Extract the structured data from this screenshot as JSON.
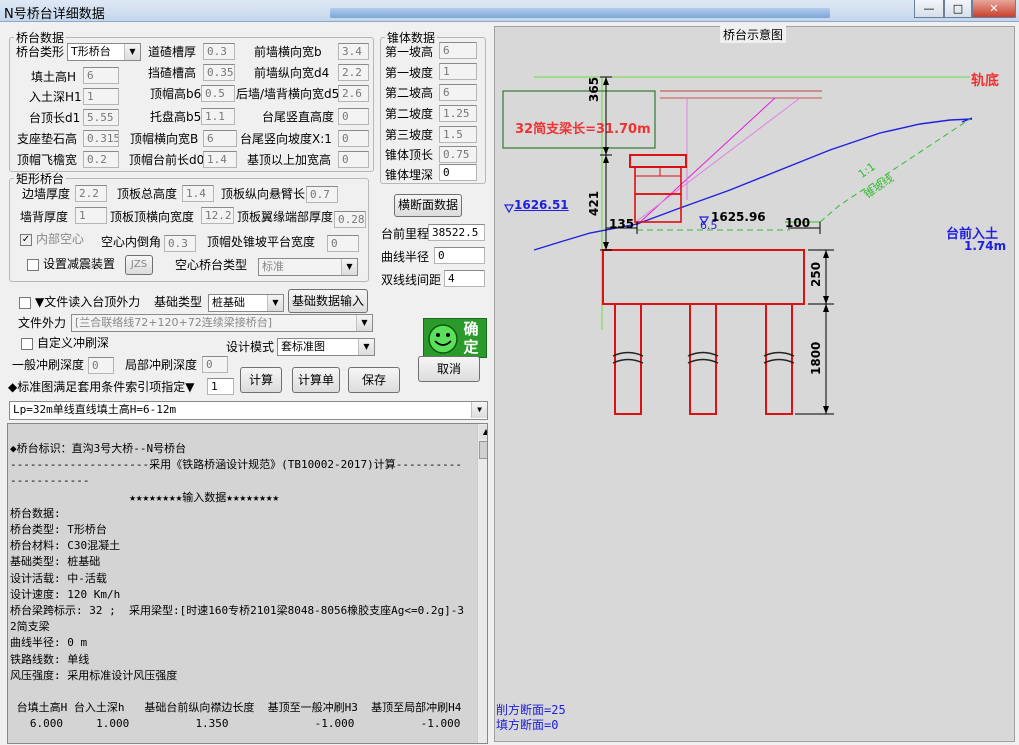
{
  "window": {
    "title": "N号桥台详细数据",
    "btn_min": "—",
    "btn_max": "□",
    "btn_close": "✕"
  },
  "bridge": {
    "group_title": "桥台数据",
    "type_label": "桥台类形",
    "type_value": "T形桥台",
    "f_label_1": "填土高H",
    "f_value_1": "6",
    "f_label_2": "入土深H1",
    "f_value_2": "1",
    "f_label_3": "台顶长d1",
    "f_value_3": "5.55",
    "f_label_4": "支座垫石高",
    "f_value_4": "0.315",
    "f_label_5": "顶帽飞檐宽",
    "f_value_5": "0.2",
    "f_label_6": "道碴槽厚",
    "f_value_6": "0.3",
    "f_label_7": "挡碴槽高",
    "f_value_7": "0.35",
    "f_label_8": "顶帽高b6",
    "f_value_8": "0.5",
    "f_label_9": "托盘高b5",
    "f_value_9": "1.1",
    "f_label_10": "顶帽横向宽B",
    "f_value_10": "6",
    "f_label_11": "顶帽台前长d0",
    "f_value_11": "1.4",
    "f_label_12": "前墙横向宽b",
    "f_value_12": "3.4",
    "f_label_13": "前墙纵向宽d4",
    "f_value_13": "2.2",
    "f_label_14": "后墙/墙背横向宽d5",
    "f_value_14": "2.6",
    "f_label_15": "台尾竖直高度",
    "f_value_15": "0",
    "f_label_16": "台尾竖向坡度X:1",
    "f_value_16": "0",
    "f_label_17": "基顶以上加宽高",
    "f_value_17": "0"
  },
  "rect": {
    "group_title": "矩形桥台",
    "f_label_1": "边墙厚度",
    "f_value_1": "2.2",
    "f_label_2": "墙背厚度",
    "f_value_2": "1",
    "f_label_3": "顶板总高度",
    "f_value_3": "1.4",
    "f_label_4": "顶板顶横向宽度",
    "f_value_4": "12.2",
    "f_label_5": "顶板纵向悬臂长",
    "f_value_5": "0.7",
    "f_label_6": "顶板翼缘端部厚度",
    "f_value_6": "0.28",
    "hollow_label": "内部空心",
    "hollow_checked": "✓",
    "chamfer_label": "空心内倒角",
    "chamfer_value": "0.3",
    "slope_width_label": "顶帽处锥坡平台宽度",
    "slope_width_value": "0",
    "damper_label": "设置减震装置",
    "damper_button": "JZS",
    "hollow_type_label": "空心桥台类型",
    "hollow_type_value": "标准"
  },
  "cone": {
    "group_title": "锥体数据",
    "f_label_1": "第一坡高",
    "f_value_1": "6",
    "f_label_2": "第一坡度",
    "f_value_2": "1",
    "f_label_3": "第二坡高",
    "f_value_3": "6",
    "f_label_4": "第二坡度",
    "f_value_4": "1.25",
    "f_label_5": "第三坡度",
    "f_value_5": "1.5",
    "f_label_6": "锥体顶长",
    "f_value_6": "0.75",
    "f_label_7": "锥体埋深",
    "f_value_7": "0"
  },
  "section_button": "横断面数据",
  "mileage_label": "台前里程",
  "mileage_value": "38522.5",
  "radius_label": "曲线半径",
  "radius_value": "0",
  "double_label": "双线线间距",
  "double_value": "4",
  "file_force_label": "▼文件读入台顶外力",
  "foundation_type_label": "基础类型",
  "foundation_type_value": "桩基础",
  "foundation_button": "基础数据输入",
  "file_ext_label": "文件外力",
  "file_ext_value": "[兰合联络线72+120+72连续梁接桥台]",
  "custom_scour_label": "自定义冲刷深",
  "design_mode_label": "设计模式",
  "design_mode_value": "套标准图",
  "general_scour_label": "一般冲刷深度",
  "general_scour_value": "0",
  "local_scour_label": "局部冲刷深度",
  "local_scour_value": "0",
  "ok_button": "确定",
  "std_index_label": "◆标准图满足套用条件索引项指定▼",
  "std_index_value": "1",
  "calc_button": "计算",
  "calc_sheet_button": "计算单",
  "save_button": "保存",
  "cancel_button": "取消",
  "std_select_value": "Lp=32m单线直线填土高H=6-12m",
  "report_text": "◆桥台标识：直沟3号大桥--N号桥台\n---------------------采用《铁路桥涵设计规范》(TB10002-2017)计算----------------------\n                  ★★★★★★★★输入数据★★★★★★★★\n桥台数据:\n桥台类型: T形桥台\n桥台材料: C30混凝土\n基础类型: 桩基础\n设计活载: 中-活载\n设计速度: 120 Km/h\n桥台梁跨标示: 32 ;  采用梁型:[时速160专桥2101梁8048-8056橡胶支座Ag<=0.2g]-32简支梁\n曲线半径: 0 m\n铁路线数: 单线\n风压强度: 采用标准设计风压强度\n\n 台填土高H 台入土深h   基础台前纵向襟边长度  基顶至一般冲刷H3  基顶至局部冲刷H4\n   6.000     1.000          1.350             -1.000          -1.000",
  "diagram": {
    "title": "桥台示意图",
    "rail_label": "轨底",
    "beam_label": "32简支梁长=31.70m",
    "dim_365": "365",
    "dim_421": "421",
    "dim_135": "135",
    "dim_100": "100",
    "dim_250": "250",
    "dim_1800": "1800",
    "elev_left": "1626.51",
    "elev_mid": "1625.96",
    "dim_mid": "6.5",
    "slope_ratio": "1:1",
    "slope_name": "锥坡线",
    "depth_label": "台前入土",
    "depth_value": "1.74m",
    "cut_area": "削方断面=25",
    "fill_area": "填方断面=0"
  }
}
